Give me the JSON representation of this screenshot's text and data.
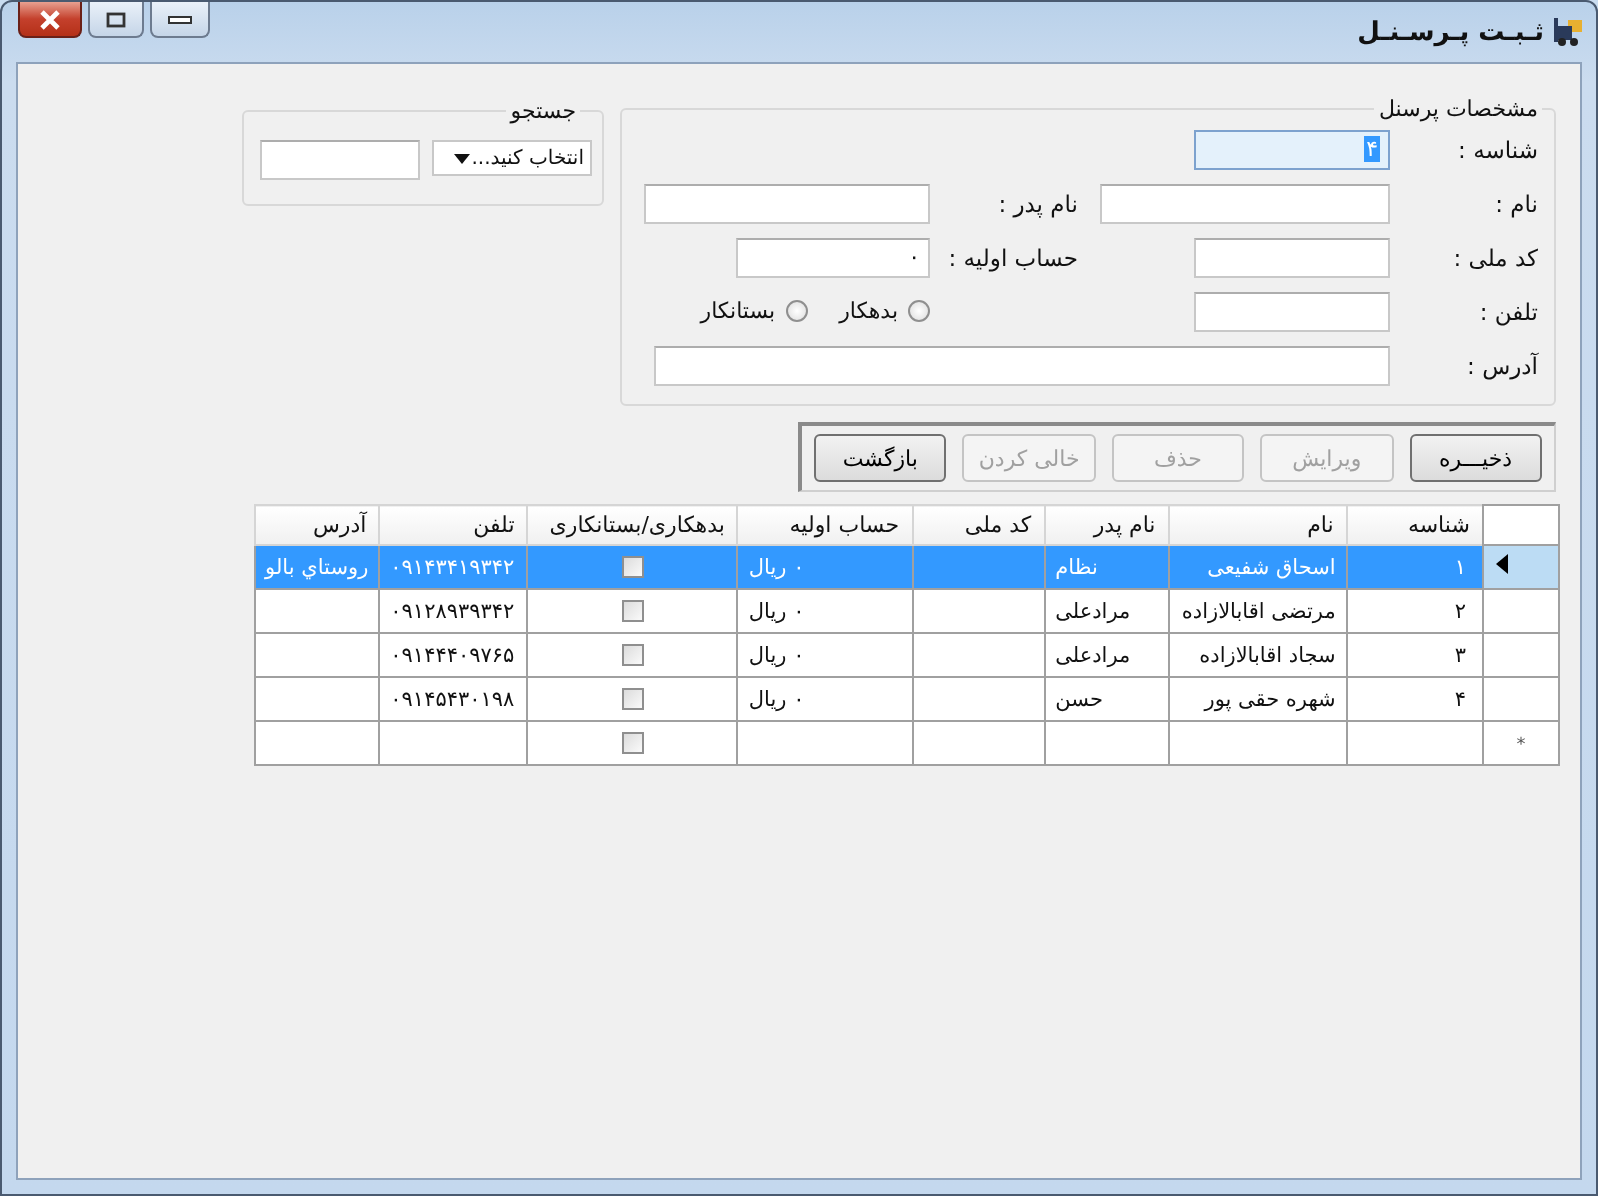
{
  "window": {
    "title": "ثـبـت پـرسـنـل"
  },
  "details": {
    "legend": "مشخصات پرسنل",
    "rows": [
      [
        {
          "kind": "field",
          "label": "شناسه :",
          "value": "۴",
          "focused": true
        }
      ],
      [
        {
          "kind": "field",
          "label": "نام :",
          "focused": false
        },
        {
          "kind": "field",
          "label": "نام پدر :",
          "focused": false
        }
      ],
      [
        {
          "kind": "field",
          "label": "کد ملی :",
          "focused": false
        },
        {
          "kind": "field",
          "label": "حساب اولیه :",
          "value": "۰",
          "focused": false
        }
      ],
      [
        {
          "kind": "field",
          "label": "تلفن :",
          "focused": false
        },
        {
          "kind": "radios",
          "options": [
            {
              "label": "بدهکار",
              "selected": false
            },
            {
              "label": "بستانکار",
              "selected": false
            }
          ]
        }
      ],
      [
        {
          "kind": "field",
          "label": "آدرس :",
          "focused": false
        }
      ]
    ]
  },
  "search": {
    "legend": "جستجو",
    "select": "انتخاب کنید..."
  },
  "buttons": [
    {
      "label": "ذخیـــره",
      "disabled": false
    },
    {
      "label": "ویرایش",
      "disabled": true
    },
    {
      "label": "حذف",
      "disabled": true
    },
    {
      "label": "خالی کردن",
      "disabled": true
    },
    {
      "label": "بازگشت",
      "disabled": false
    }
  ],
  "grid": {
    "columns": [
      "شناسه",
      "نام",
      "نام پدر",
      "کد ملی",
      "حساب اولیه",
      "بدهکاری/بستانکاری",
      "تلفن",
      "آدرس"
    ],
    "rows": [
      {
        "selected": true,
        "id": "۱",
        "name": "اسحاق شفیعی",
        "father": "نظام",
        "balance": "۰ ریال",
        "checked": false,
        "phone": "۰۹۱۴۳۴۱۹۳۴۲",
        "address": "روستاي بالو"
      },
      {
        "selected": false,
        "id": "۲",
        "name": "مرتضی اقابالازاده",
        "father": "مرادعلی",
        "balance": "۰ ریال",
        "checked": false,
        "phone": "۰۹۱۲۸۹۳۹۳۴۲"
      },
      {
        "selected": false,
        "id": "۳",
        "name": "سجاد اقابالازاده",
        "father": "مرادعلی",
        "balance": "۰ ریال",
        "checked": false,
        "phone": "۰۹۱۴۴۴۰۹۷۶۵"
      },
      {
        "selected": false,
        "id": "۴",
        "name": "شهره حقی پور",
        "father": "حسن",
        "balance": "۰ ریال",
        "checked": false,
        "phone": "۰۹۱۴۵۴۳۰۱۹۸"
      }
    ],
    "new_row": {
      "marker": "*",
      "checked": false
    }
  }
}
